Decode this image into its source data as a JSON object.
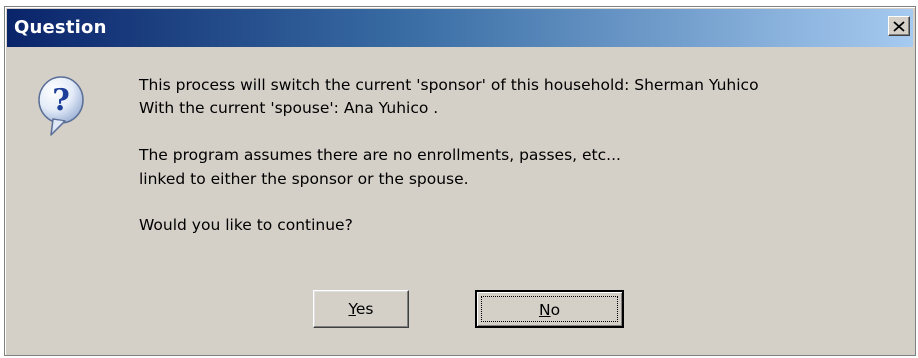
{
  "window": {
    "title": "Question",
    "close_glyph": "×"
  },
  "icon": {
    "name": "question-icon",
    "glyph": "?"
  },
  "message": {
    "line1": "This process will switch the current 'sponsor' of this household:  Sherman Yuhico",
    "line2": "With the current 'spouse':  Ana Yuhico .",
    "line3": "The program assumes there are no enrollments, passes, etc...",
    "line4": "linked to either the sponsor or the spouse.",
    "line5": "Would you like to continue?"
  },
  "buttons": {
    "yes": {
      "accel": "Y",
      "rest": "es"
    },
    "no": {
      "accel": "N",
      "rest": "o"
    }
  }
}
